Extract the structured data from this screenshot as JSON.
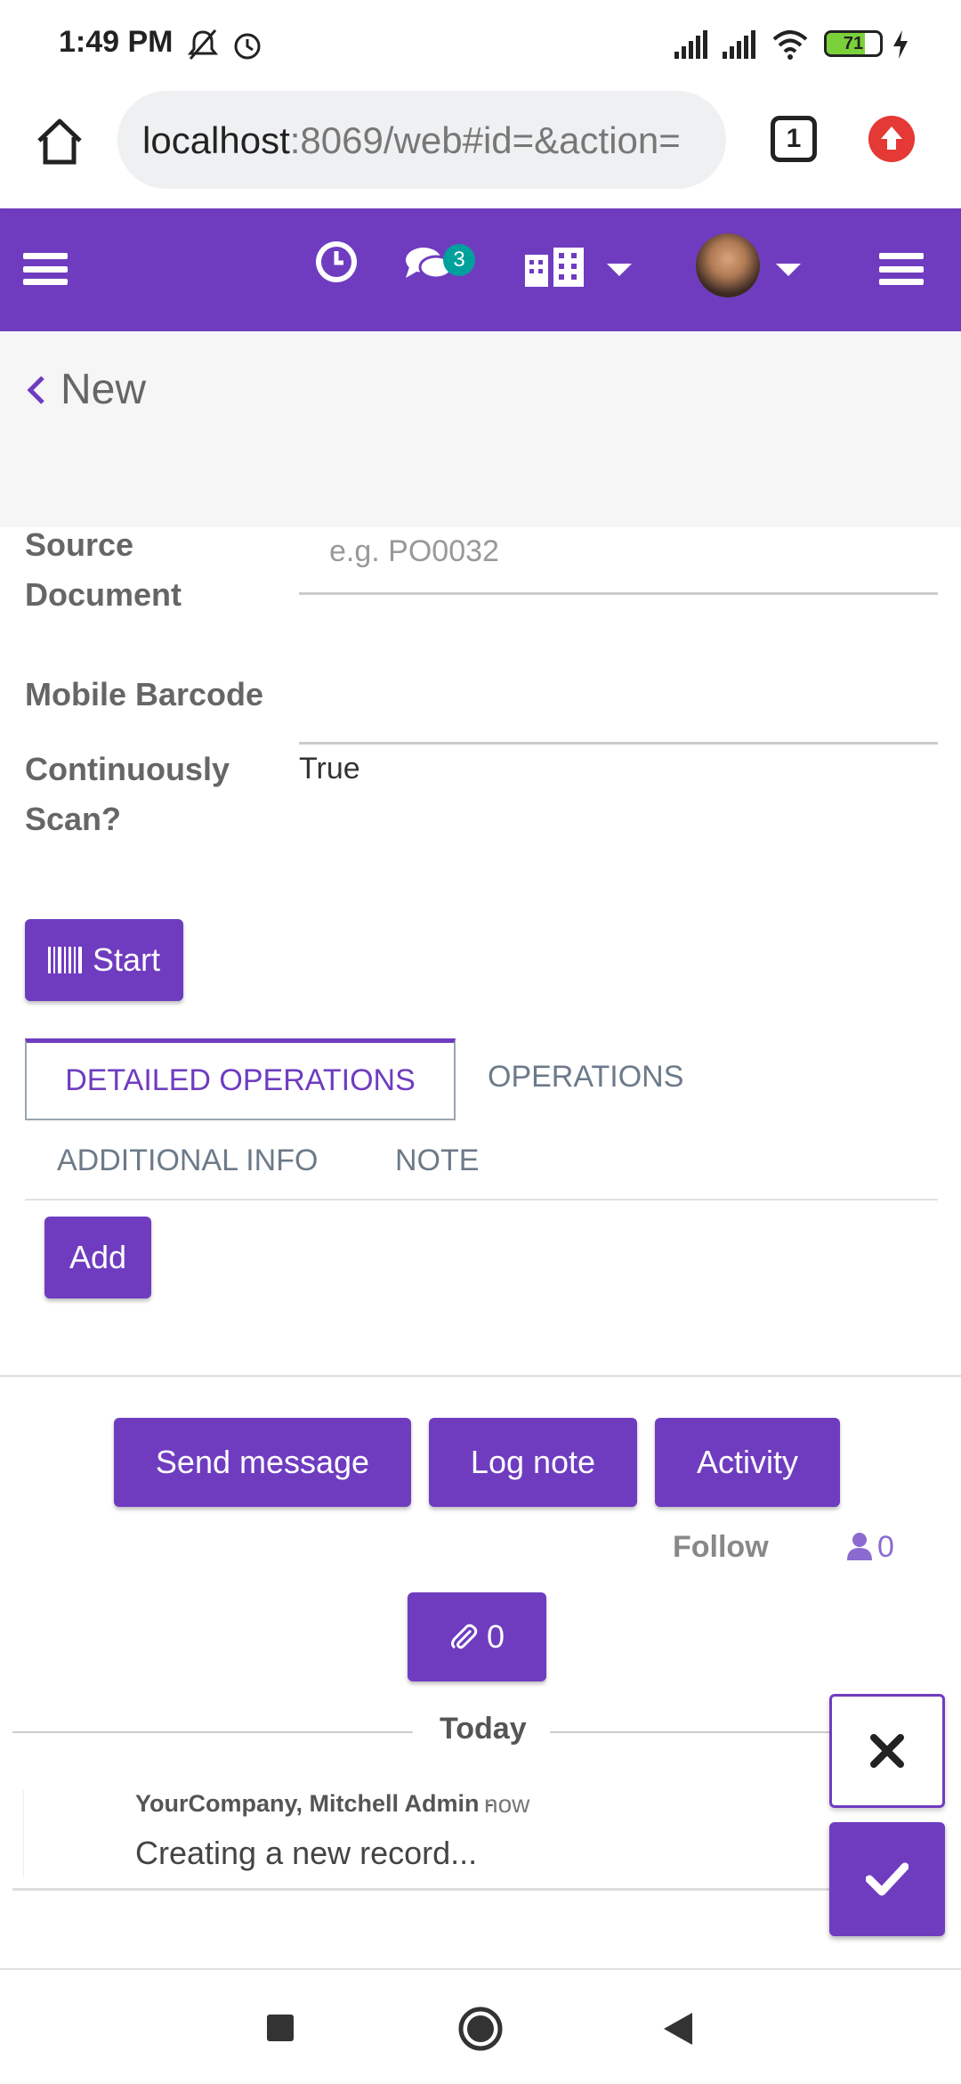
{
  "status_bar": {
    "time": "1:49 PM",
    "battery": "71",
    "icons": [
      "mute-icon",
      "alarm-icon",
      "signal-icon",
      "signal-icon",
      "wifi-icon",
      "battery-icon",
      "charging-icon"
    ]
  },
  "browser": {
    "url_host": "localhost",
    "url_rest": ":8069/web#id=&action=",
    "tab_count": "1"
  },
  "navbar": {
    "chat_badge": "3",
    "colors": {
      "primary": "#6f3cc0",
      "badge": "#00a09d"
    }
  },
  "breadcrumb": {
    "title": "New"
  },
  "form": {
    "source_document": {
      "label_line1": "Source",
      "label_line2": "Document",
      "placeholder": "e.g. PO0032"
    },
    "mobile_barcode": {
      "label": "Mobile Barcode",
      "value": ""
    },
    "continuously_scan": {
      "label_line1": "Continuously",
      "label_line2": "Scan?",
      "value": "True"
    },
    "start_button": "Start"
  },
  "tabs": {
    "active": "DETAILED OPERATIONS",
    "operations": "OPERATIONS",
    "additional_info": "ADDITIONAL INFO",
    "note": "NOTE"
  },
  "add_button": "Add",
  "chatter": {
    "send_message": "Send message",
    "log_note": "Log note",
    "activity": "Activity",
    "follow": "Follow",
    "followers_count": "0",
    "attachments_count": "0",
    "today": "Today",
    "message": {
      "author": "YourCompany, Mitchell Admin",
      "separator": "-",
      "date": "now",
      "body": "Creating a new record..."
    }
  }
}
